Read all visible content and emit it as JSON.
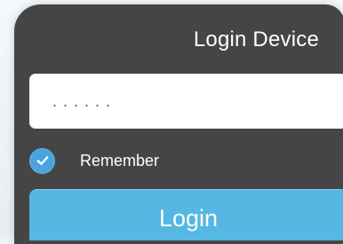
{
  "header": {
    "title": "Login Device"
  },
  "form": {
    "password_value": "......",
    "remember_label": "Remember",
    "remember_checked": true,
    "login_label": "Login"
  },
  "icons": {
    "remember_check": "check-circle-icon"
  },
  "colors": {
    "panel": "#454545",
    "accent": "#55b7e2",
    "check": "#4aa3df",
    "text_light": "#ffffff"
  }
}
